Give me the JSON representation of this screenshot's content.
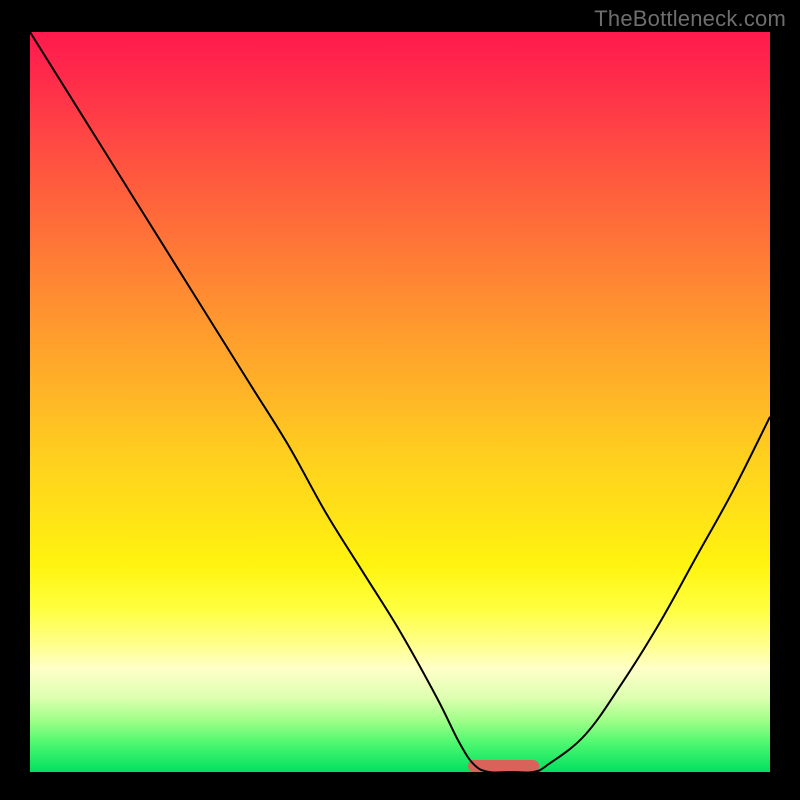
{
  "watermark": "TheBottleneck.com",
  "chart_data": {
    "type": "line",
    "title": "",
    "xlabel": "",
    "ylabel": "",
    "xlim": [
      0,
      100
    ],
    "ylim": [
      0,
      100
    ],
    "x": [
      0,
      5,
      10,
      15,
      20,
      25,
      30,
      35,
      40,
      45,
      50,
      55,
      58,
      60,
      62,
      65,
      68,
      70,
      75,
      80,
      85,
      90,
      95,
      100
    ],
    "values": [
      100,
      92,
      84,
      76,
      68,
      60,
      52,
      44,
      35,
      27,
      19,
      10,
      4,
      1,
      0,
      0,
      0,
      1,
      5,
      12,
      20,
      29,
      38,
      48
    ],
    "flat_segment": {
      "x_start": 60,
      "x_end": 68,
      "y": 0,
      "color": "#d9625a",
      "stroke_width": 12
    },
    "curve_color": "#000000",
    "curve_width": 2
  }
}
